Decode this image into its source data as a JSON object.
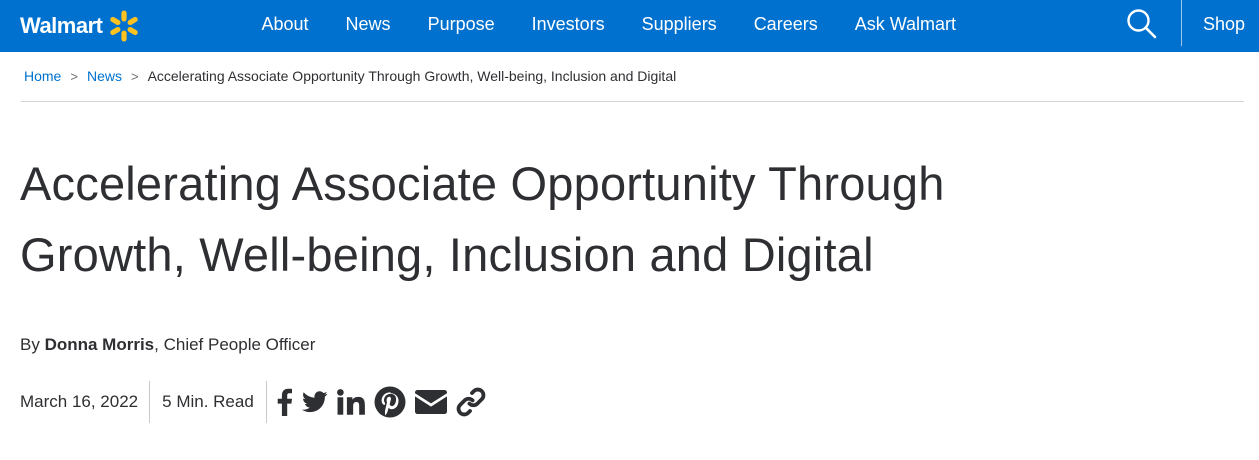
{
  "header": {
    "logo_text": "Walmart",
    "nav_items": [
      "About",
      "News",
      "Purpose",
      "Investors",
      "Suppliers",
      "Careers",
      "Ask Walmart"
    ],
    "shop_label": "Shop",
    "brand_color": "#0071ce",
    "spark_color": "#ffc220"
  },
  "breadcrumb": {
    "home": "Home",
    "news": "News",
    "separator": ">",
    "current": "Accelerating Associate Opportunity Through Growth, Well-being, Inclusion and Digital"
  },
  "article": {
    "title_line1": "Accelerating Associate Opportunity Through",
    "title_line2": "Growth, Well-being, Inclusion and Digital",
    "byline_prefix": "By",
    "author": "Donna Morris",
    "author_role": ", Chief People Officer",
    "date": "March 16, 2022",
    "read_time": "5 Min. Read"
  },
  "share_icons": [
    "facebook-icon",
    "twitter-icon",
    "linkedin-icon",
    "pinterest-icon",
    "email-icon",
    "link-icon"
  ]
}
